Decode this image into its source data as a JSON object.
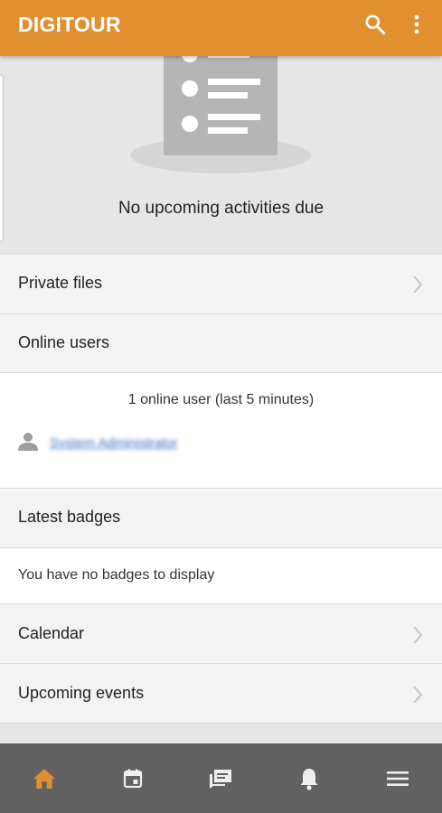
{
  "app_bar": {
    "title": "DIGITOUR",
    "search_icon": "search-icon",
    "more_icon": "more-vert-icon"
  },
  "timeline": {
    "illustration_icon": "empty-list-icon",
    "empty_message": "No upcoming activities due"
  },
  "blocks": {
    "private_files": {
      "label": "Private files",
      "icon": "chevron-right-icon"
    },
    "online_users": {
      "label": "Online users",
      "count_text": "1 online user (last 5 minutes)",
      "users": [
        {
          "name": "System Administrator",
          "icon": "person-icon"
        }
      ]
    },
    "latest_badges": {
      "label": "Latest badges",
      "empty_text": "You have no badges to display"
    },
    "calendar": {
      "label": "Calendar",
      "icon": "chevron-right-icon"
    },
    "upcoming_events": {
      "label": "Upcoming events",
      "icon": "chevron-right-icon"
    }
  },
  "bottom_nav": {
    "tabs": [
      {
        "name": "home",
        "icon": "home-icon",
        "active": true
      },
      {
        "name": "calendar",
        "icon": "calendar-icon",
        "active": false
      },
      {
        "name": "messages",
        "icon": "messages-icon",
        "active": false
      },
      {
        "name": "notifications",
        "icon": "bell-icon",
        "active": false
      },
      {
        "name": "menu",
        "icon": "menu-icon",
        "active": false
      }
    ]
  },
  "colors": {
    "accent": "#e1902f",
    "nav_background": "#616161",
    "nav_inactive_icon": "#eeeeee",
    "link": "#3a72c4"
  }
}
